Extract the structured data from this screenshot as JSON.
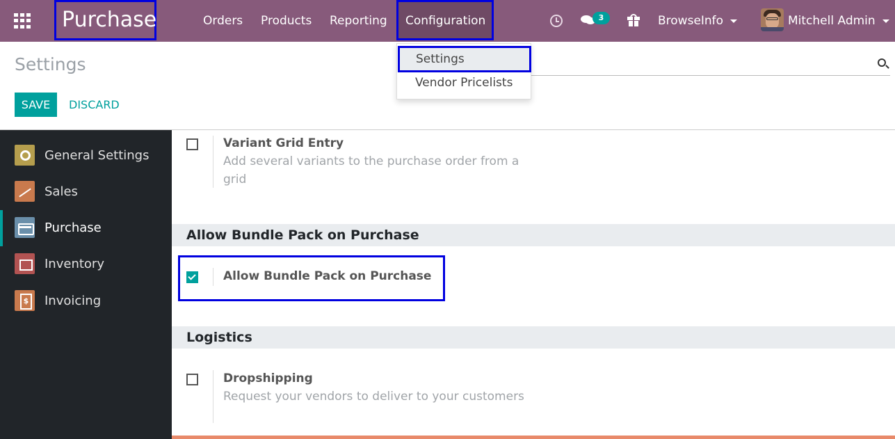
{
  "navbar": {
    "app_name": "Purchase",
    "menu": [
      "Orders",
      "Products",
      "Reporting",
      "Configuration"
    ],
    "chat_badge": "3",
    "company": "BrowseInfo",
    "user": "Mitchell Admin",
    "colors": {
      "bar": "#875A7B",
      "highlight": "#0000e0"
    }
  },
  "dropdown": {
    "items": [
      "Settings",
      "Vendor Pricelists"
    ]
  },
  "control_panel": {
    "title": "Settings",
    "save_label": "SAVE",
    "discard_label": "DISCARD"
  },
  "sidebar": {
    "items": [
      {
        "label": "General Settings",
        "icon": "gear-icon"
      },
      {
        "label": "Sales",
        "icon": "sales-chart-icon"
      },
      {
        "label": "Purchase",
        "icon": "purchase-card-icon",
        "active": true
      },
      {
        "label": "Inventory",
        "icon": "inventory-box-icon"
      },
      {
        "label": "Invoicing",
        "icon": "invoice-icon"
      }
    ]
  },
  "content": {
    "variant_grid": {
      "title": "Variant Grid Entry",
      "description": "Add several variants to the purchase order from a grid",
      "checked": false
    },
    "bundle_section": {
      "heading": "Allow Bundle Pack on Purchase"
    },
    "bundle_setting": {
      "title": "Allow Bundle Pack on Purchase",
      "checked": true
    },
    "logistics_section": {
      "heading": "Logistics"
    },
    "dropshipping": {
      "title": "Dropshipping",
      "description": "Request your vendors to deliver to your customers",
      "checked": false
    },
    "accent": "#00A09D"
  }
}
